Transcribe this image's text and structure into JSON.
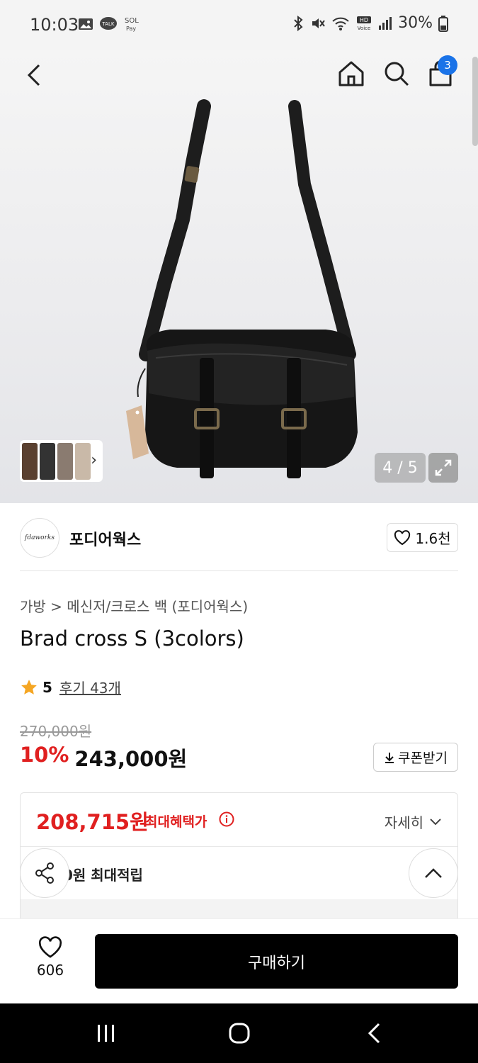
{
  "status_bar": {
    "time": "10:03",
    "battery": "30%"
  },
  "nav": {
    "cart_count": "3"
  },
  "gallery": {
    "counter": "4 / 5"
  },
  "brand": {
    "name": "포디어웍스",
    "logo_text": "fdaworks",
    "likes": "1.6천"
  },
  "product": {
    "breadcrumb_category": "가방",
    "breadcrumb_sep": ">",
    "breadcrumb_sub": "메신저/크로스 백 (포디어웍스)",
    "title": "Brad cross S (3colors)",
    "rating": "5",
    "reviews": "후기 43개",
    "original_price": "270,000원",
    "discount": "10%",
    "price": "243,000원",
    "coupon_label": "쿠폰받기"
  },
  "benefit": {
    "max_price": "208,715원",
    "max_label": "최대혜택가",
    "detail_label": "자세히",
    "points_text": "0원 최대적립"
  },
  "bottom": {
    "wish_count": "606",
    "buy_label": "구매하기"
  },
  "colors": {
    "accent_red": "#e02020",
    "badge_blue": "#1a73e8",
    "buy_black": "#000000"
  }
}
